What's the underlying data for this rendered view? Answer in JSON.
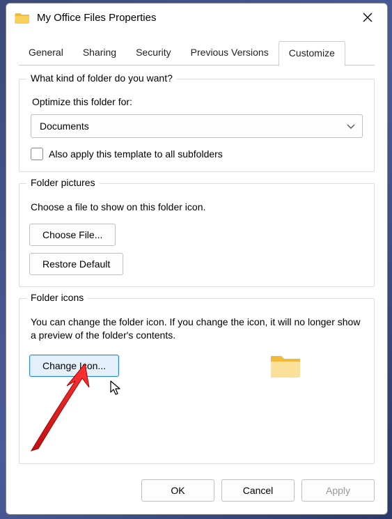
{
  "titlebar": {
    "title": "My Office Files Properties"
  },
  "tabs": {
    "general": "General",
    "sharing": "Sharing",
    "security": "Security",
    "previous": "Previous Versions",
    "customize": "Customize"
  },
  "group1": {
    "legend": "What kind of folder do you want?",
    "optimize_label": "Optimize this folder for:",
    "select_value": "Documents",
    "checkbox_label": "Also apply this template to all subfolders"
  },
  "group2": {
    "legend": "Folder pictures",
    "desc": "Choose a file to show on this folder icon.",
    "choose_file": "Choose File...",
    "restore_default": "Restore Default"
  },
  "group3": {
    "legend": "Folder icons",
    "desc": "You can change the folder icon. If you change the icon, it will no longer show a preview of the folder's contents.",
    "change_icon": "Change Icon..."
  },
  "footer": {
    "ok": "OK",
    "cancel": "Cancel",
    "apply": "Apply"
  }
}
